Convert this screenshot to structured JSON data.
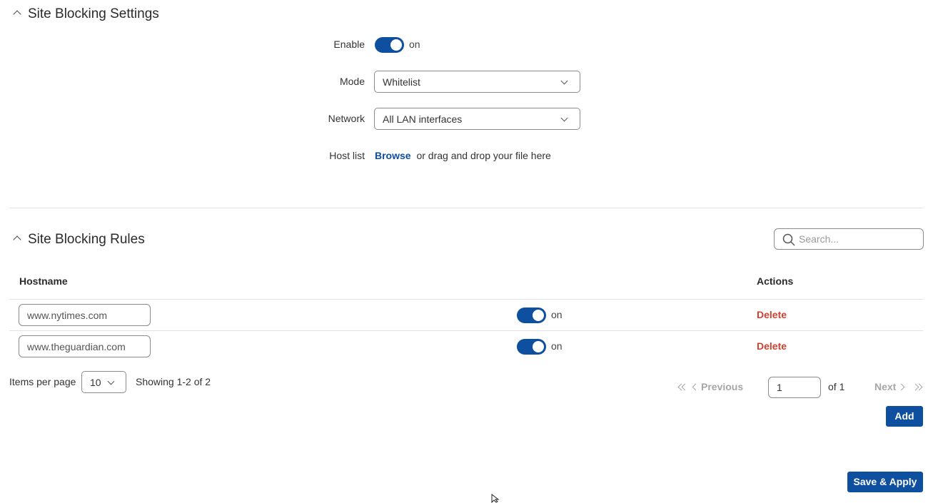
{
  "settings": {
    "title": "Site Blocking Settings",
    "enable_label": "Enable",
    "enable_state": "on",
    "mode_label": "Mode",
    "mode_value": "Whitelist",
    "network_label": "Network",
    "network_value": "All LAN interfaces",
    "hostlist_label": "Host list",
    "browse_text": "Browse",
    "drag_text": "or drag and drop your file here"
  },
  "rules": {
    "title": "Site Blocking Rules",
    "search_placeholder": "Search...",
    "col_hostname": "Hostname",
    "col_actions": "Actions",
    "rows": [
      {
        "hostname": "www.nytimes.com",
        "state": "on",
        "delete": "Delete"
      },
      {
        "hostname": "www.theguardian.com",
        "state": "on",
        "delete": "Delete"
      }
    ]
  },
  "pagination": {
    "items_per_page_label": "Items per page",
    "items_per_page_value": "10",
    "showing": "Showing 1-2 of 2",
    "previous": "Previous",
    "page_value": "1",
    "of_text": "of 1",
    "next": "Next"
  },
  "buttons": {
    "add": "Add",
    "save_apply": "Save & Apply"
  },
  "colors": {
    "accent": "#0e4fa0",
    "danger": "#d0412e"
  }
}
